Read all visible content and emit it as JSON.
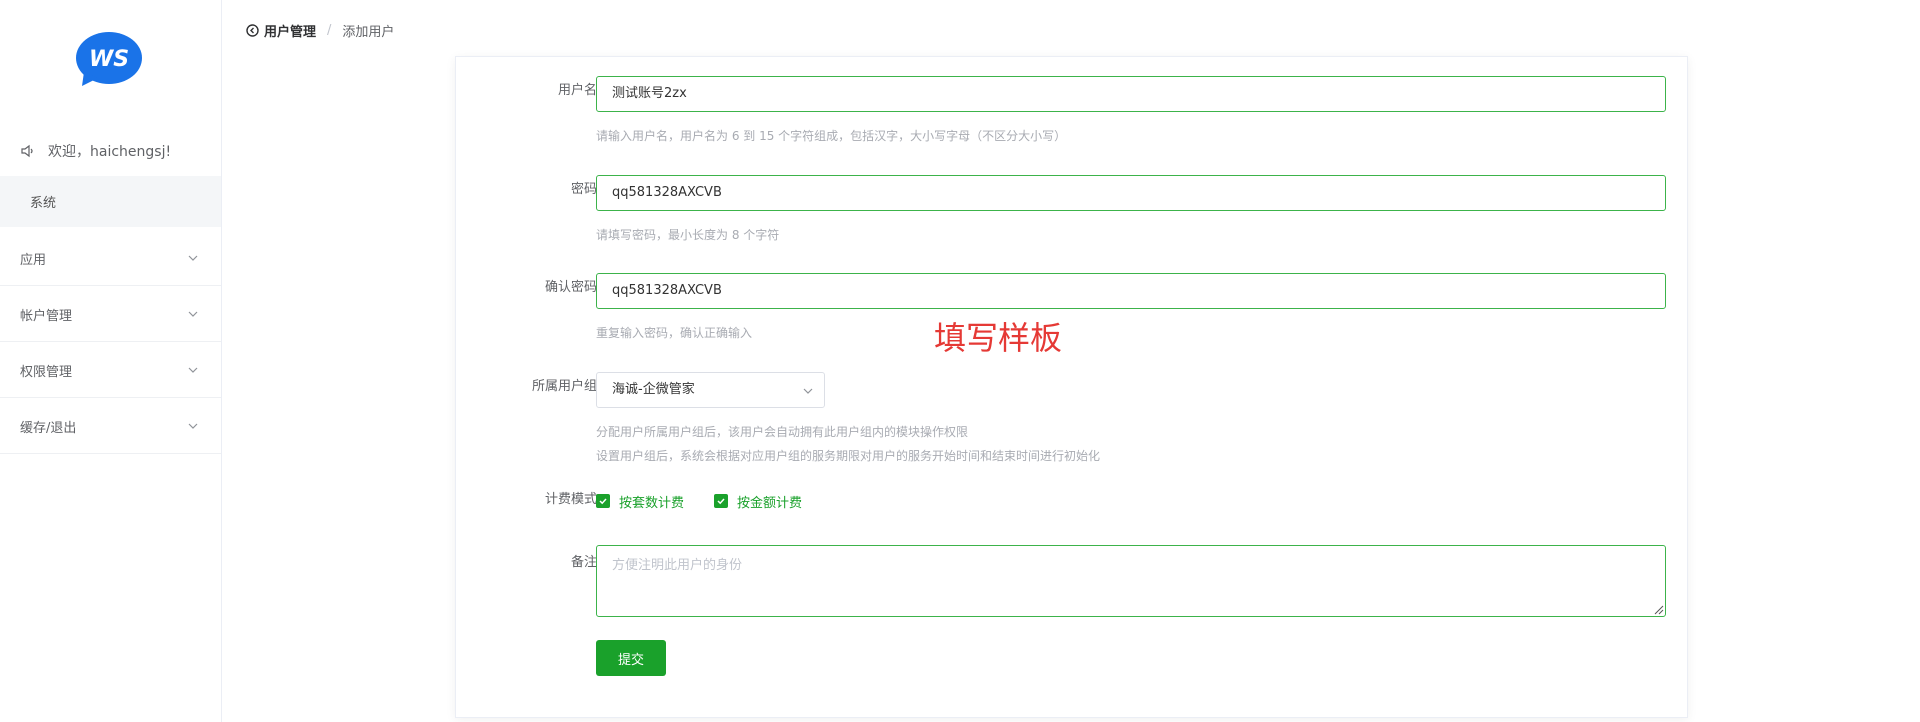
{
  "sidebar": {
    "logo_text": "WS",
    "welcome": "欢迎，haichengsj!",
    "system_label": "系统",
    "items": [
      {
        "label": "应用"
      },
      {
        "label": "帐户管理"
      },
      {
        "label": "权限管理"
      },
      {
        "label": "缓存/退出"
      }
    ]
  },
  "breadcrumb": {
    "back_label": "用户管理",
    "separator": "/",
    "current": "添加用户"
  },
  "form": {
    "username": {
      "label": "用户名",
      "value": "测试账号2zx",
      "hint": "请输入用户名，用户名为 6 到 15 个字符组成，包括汉字，大小写字母（不区分大小写）"
    },
    "password": {
      "label": "密码",
      "value": "qq581328AXCVB",
      "hint": "请填写密码，最小长度为 8 个字符"
    },
    "confirm_password": {
      "label": "确认密码",
      "value": "qq581328AXCVB",
      "hint": "重复输入密码，确认正确输入"
    },
    "user_group": {
      "label": "所属用户组",
      "selected": "海诚-企微管家",
      "hint_line1": "分配用户所属用户组后，该用户会自动拥有此用户组内的模块操作权限",
      "hint_line2": "设置用户组后，系统会根据对应用户组的服务期限对用户的服务开始时间和结束时间进行初始化"
    },
    "billing": {
      "label": "计费模式",
      "options": [
        {
          "label": "按套数计费",
          "checked": true
        },
        {
          "label": "按金额计费",
          "checked": true
        }
      ]
    },
    "remark": {
      "label": "备注",
      "placeholder": "方便注明此用户的身份"
    },
    "submit_label": "提交"
  },
  "annotation": "填写样板",
  "colors": {
    "accent": "#1aa12b",
    "input_border": "#3cb34a",
    "annotation": "#e53935",
    "logo": "#1a73e8"
  }
}
